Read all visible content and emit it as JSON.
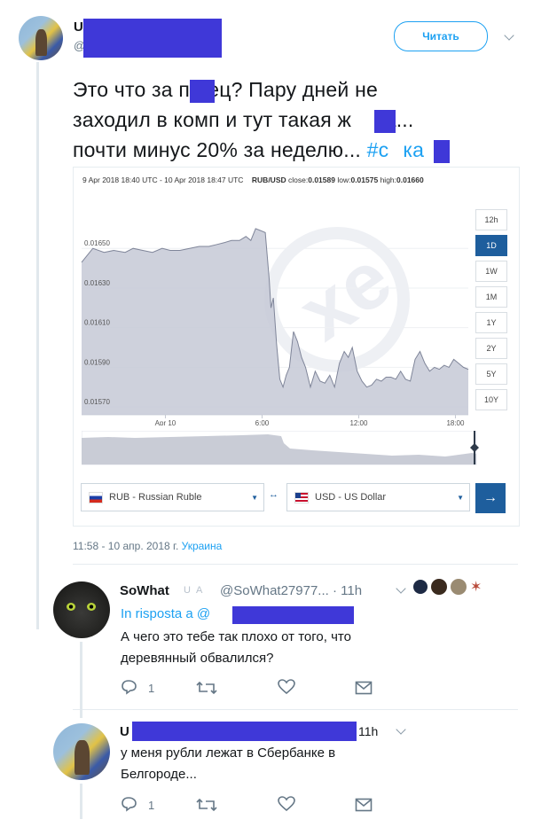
{
  "main_tweet": {
    "name_initial": "U",
    "handle_initial": "@",
    "follow_label": "Читать",
    "text_line1": "Это что за п  дец? Пару дней не",
    "text_line2a": "заходил в комп и тут такая ж",
    "text_line2b": "па...",
    "text_line3a": "почти минус 20% за неделю... ",
    "hashtag_a": "#с",
    "hashtag_b": "ка",
    "timestamp": "11:58 - 10 апр. 2018 г.",
    "location": "Украина"
  },
  "chart": {
    "header_range": "9 Apr 2018 18:40 UTC - 10 Apr 2018 18:47 UTC",
    "pair": "RUB/USD",
    "close_label": "close:",
    "close_value": "0.01589",
    "low_label": "low:",
    "low_value": "0.01575",
    "high_label": "high:",
    "high_value": "0.01660",
    "timeframes": [
      "12h",
      "1D",
      "1W",
      "1M",
      "1Y",
      "2Y",
      "5Y",
      "10Y"
    ],
    "active_timeframe": "1D",
    "from_currency": "RUB - Russian Ruble",
    "to_currency": "USD - US Dollar",
    "swap_glyph": "↔",
    "go_glyph": "→"
  },
  "chart_data": {
    "type": "area",
    "title": "",
    "xlabel": "",
    "ylabel": "",
    "x_ticks": [
      "Apr 10",
      "6:00",
      "12:00",
      "18:00"
    ],
    "y_ticks": [
      "0.01650",
      "0.01630",
      "0.01610",
      "0.01590",
      "0.01570"
    ],
    "ylim": [
      0.01566,
      0.01668
    ],
    "x_range_hours": [
      -5.2,
      18.8
    ],
    "series": [
      {
        "x": [
          -5.2,
          -4.5,
          -3.8,
          -3.2,
          -2.5,
          -2.0,
          -1.4,
          -0.8,
          -0.2,
          0.3,
          0.9,
          1.5,
          2.1,
          2.7,
          3.2,
          3.7,
          4.1,
          4.6,
          5.0,
          5.3,
          5.6,
          5.9,
          6.2,
          6.45,
          6.55,
          6.7,
          6.9,
          7.1,
          7.3,
          7.5,
          7.7,
          7.95,
          8.2,
          8.45,
          8.7,
          9.0,
          9.3,
          9.6,
          9.9,
          10.2,
          10.5,
          10.8,
          11.1,
          11.35,
          11.6,
          11.9,
          12.2,
          12.5,
          12.8,
          13.1,
          13.4,
          13.7,
          14.0,
          14.3,
          14.6,
          14.9,
          15.2,
          15.5,
          15.8,
          16.1,
          16.4,
          16.7,
          17.0,
          17.3,
          17.6,
          17.9,
          18.2,
          18.5,
          18.8
        ],
        "y": [
          0.01643,
          0.0165,
          0.01648,
          0.01649,
          0.01648,
          0.0165,
          0.01649,
          0.01648,
          0.0165,
          0.01649,
          0.01649,
          0.0165,
          0.01651,
          0.01651,
          0.01652,
          0.01653,
          0.01654,
          0.01654,
          0.01656,
          0.01654,
          0.0166,
          0.01659,
          0.01658,
          0.01634,
          0.0162,
          0.01625,
          0.01602,
          0.01584,
          0.0158,
          0.01586,
          0.0159,
          0.01608,
          0.01603,
          0.01595,
          0.0159,
          0.0158,
          0.01588,
          0.01583,
          0.01582,
          0.01586,
          0.0158,
          0.01592,
          0.01598,
          0.01595,
          0.016,
          0.01588,
          0.01583,
          0.0158,
          0.01581,
          0.01584,
          0.01583,
          0.01585,
          0.01585,
          0.01584,
          0.01588,
          0.01584,
          0.01583,
          0.01594,
          0.01598,
          0.01592,
          0.01588,
          0.0159,
          0.01589,
          0.01591,
          0.0159,
          0.01594,
          0.01592,
          0.0159,
          0.01589
        ]
      }
    ]
  },
  "reply1": {
    "name": "SoWhat",
    "handle": "@SoWhat27977...",
    "sep": "·",
    "time": "11h",
    "in_reply": "In risposta a @",
    "text_line1": "А чего это тебе так плохо от того, что",
    "text_line2": "деревянный обвалился?",
    "reply_count": "1"
  },
  "reply2": {
    "name_initial": "U",
    "time": "11h",
    "text_line1": "у меня рубли лежат в Сбербанке в",
    "text_line2": "Белгороде...",
    "reply_count": "1"
  },
  "colors": {
    "accent": "#1da1f2",
    "redaction": "#3f38d8",
    "chart_area": "#c5c9d6",
    "chart_line": "#7f8599",
    "chart_button": "#1e5e9d"
  }
}
